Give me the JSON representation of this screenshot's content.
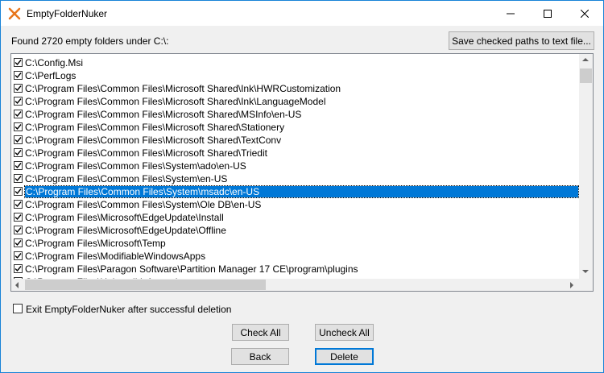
{
  "window": {
    "title": "EmptyFolderNuker"
  },
  "status": {
    "found_text": "Found 2720 empty folders under C:\\:"
  },
  "buttons": {
    "save": "Save checked paths to text file...",
    "check_all": "Check All",
    "uncheck_all": "Uncheck All",
    "back": "Back",
    "delete": "Delete"
  },
  "exit_option": {
    "label": "Exit EmptyFolderNuker after successful deletion",
    "checked": false
  },
  "folders": [
    "C:\\Config.Msi",
    "C:\\PerfLogs",
    "C:\\Program Files\\Common Files\\Microsoft Shared\\Ink\\HWRCustomization",
    "C:\\Program Files\\Common Files\\Microsoft Shared\\Ink\\LanguageModel",
    "C:\\Program Files\\Common Files\\Microsoft Shared\\MSInfo\\en-US",
    "C:\\Program Files\\Common Files\\Microsoft Shared\\Stationery",
    "C:\\Program Files\\Common Files\\Microsoft Shared\\TextConv",
    "C:\\Program Files\\Common Files\\Microsoft Shared\\Triedit",
    "C:\\Program Files\\Common Files\\System\\ado\\en-US",
    "C:\\Program Files\\Common Files\\System\\en-US",
    "C:\\Program Files\\Common Files\\System\\msadc\\en-US",
    "C:\\Program Files\\Common Files\\System\\Ole DB\\en-US",
    "C:\\Program Files\\Microsoft\\EdgeUpdate\\Install",
    "C:\\Program Files\\Microsoft\\EdgeUpdate\\Offline",
    "C:\\Program Files\\Microsoft\\Temp",
    "C:\\Program Files\\ModifiableWindowsApps",
    "C:\\Program Files\\Paragon Software\\Partition Manager 17 CE\\program\\plugins",
    "C:\\Program Files\\Uninstall Information"
  ],
  "selected_index": 10
}
